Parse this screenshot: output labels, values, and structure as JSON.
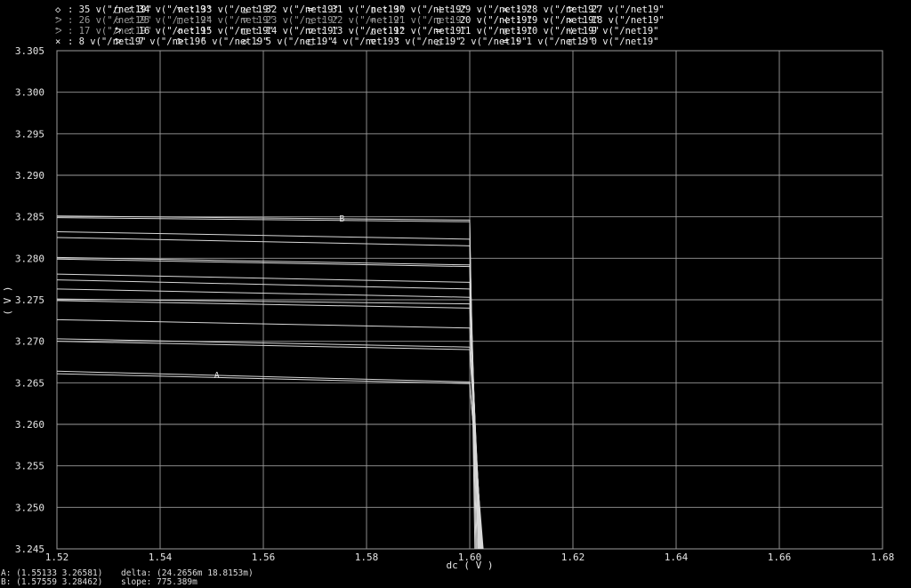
{
  "legend": [
    {
      "sym": "◇",
      "id": "35",
      "label": "v(\"/net19\""
    },
    {
      "sym": "□",
      "id": "34",
      "label": "v(\"/net19\""
    },
    {
      "sym": "▽",
      "id": "33",
      "label": "v(\"/net19\""
    },
    {
      "sym": "△",
      "id": "32",
      "label": "v(\"/net19\""
    },
    {
      "sym": "═",
      "id": "31",
      "label": "v(\"/net19\""
    },
    {
      "sym": "▯",
      "id": "30",
      "label": "v(\"/net19\""
    },
    {
      "sym": "⊹",
      "id": "29",
      "label": "v(\"/net19\""
    },
    {
      "sym": "×",
      "id": "28",
      "label": "v(\"/net19\""
    },
    {
      "sym": "ᕗ",
      "id": "27",
      "label": "v(\"/net19\""
    },
    {
      "sym": "ᕗ",
      "id": "26",
      "label": "v(\"/net19\""
    },
    {
      "sym": "◇",
      "id": "25",
      "label": "v(\"/net19\""
    },
    {
      "sym": "□",
      "id": "24",
      "label": "v(\"/net19\""
    },
    {
      "sym": "▽",
      "id": "23",
      "label": "v(\"/net19\""
    },
    {
      "sym": "△",
      "id": "22",
      "label": "v(\"/net19\""
    },
    {
      "sym": "═",
      "id": "21",
      "label": "v(\"/net19\""
    },
    {
      "sym": "▯",
      "id": "20",
      "label": "v(\"/net19\""
    },
    {
      "sym": "⊹",
      "id": "19",
      "label": "v(\"/net19\""
    },
    {
      "sym": "×",
      "id": "18",
      "label": "v(\"/net19\""
    },
    {
      "sym": "ᕗ",
      "id": "17",
      "label": "v(\"/net19\""
    },
    {
      "sym": "ᕗ",
      "id": "16",
      "label": "v(\"/net19\""
    },
    {
      "sym": "◇",
      "id": "15",
      "label": "v(\"/net19\""
    },
    {
      "sym": "□",
      "id": "14",
      "label": "v(\"/net19\""
    },
    {
      "sym": "▽",
      "id": "13",
      "label": "v(\"/net19\""
    },
    {
      "sym": "△",
      "id": "12",
      "label": "v(\"/net19\""
    },
    {
      "sym": "═",
      "id": "11",
      "label": "v(\"/net19\""
    },
    {
      "sym": "▯",
      "id": "10",
      "label": "v(\"/net19\""
    },
    {
      "sym": "⊹",
      "id": "9",
      "label": "v(\"/net19\""
    },
    {
      "sym": "×",
      "id": "8",
      "label": "v(\"/net19\""
    },
    {
      "sym": "ᕗ",
      "id": "7",
      "label": "v(\"/net19\""
    },
    {
      "sym": "ᕗ",
      "id": "6",
      "label": "v(\"/net19\""
    },
    {
      "sym": "◇",
      "id": "5",
      "label": "v(\"/net19\""
    },
    {
      "sym": "□",
      "id": "4",
      "label": "v(\"/net19\""
    },
    {
      "sym": "▽",
      "id": "3",
      "label": "v(\"/net19\""
    },
    {
      "sym": "△",
      "id": "2",
      "label": "v(\"/net19\""
    },
    {
      "sym": "═",
      "id": "1",
      "label": "v(\"/net19\""
    },
    {
      "sym": "▯",
      "id": "0",
      "label": "v(\"/net19\""
    }
  ],
  "legend_dim_ids": [
    "26",
    "25",
    "24",
    "23",
    "22",
    "21",
    "17"
  ],
  "readout": {
    "a": "A: (1.55133 3.26581)",
    "b": "B: (1.57559 3.28462)",
    "delta": "delta: (24.2656m 18.8153m)",
    "slope": "slope: 775.389m"
  },
  "chart_data": {
    "type": "line",
    "title": "",
    "xlabel": "dc ( V )",
    "ylabel": "( V )",
    "xlim": [
      1.52,
      1.68
    ],
    "ylim": [
      3.245,
      3.305
    ],
    "xticks": [
      "1.52",
      "1.54",
      "1.56",
      "1.58",
      "1.60",
      "1.62",
      "1.64",
      "1.66",
      "1.68"
    ],
    "xtick_values": [
      1.52,
      1.54,
      1.56,
      1.58,
      1.6,
      1.62,
      1.64,
      1.66,
      1.68
    ],
    "yticks": [
      "3.305",
      "3.300",
      "3.295",
      "3.290",
      "3.285",
      "3.280",
      "3.275",
      "3.270",
      "3.265",
      "3.260",
      "3.255",
      "3.250",
      "3.245"
    ],
    "ytick_values": [
      3.305,
      3.3,
      3.295,
      3.29,
      3.285,
      3.28,
      3.275,
      3.27,
      3.265,
      3.26,
      3.255,
      3.25,
      3.245
    ],
    "grid": true,
    "colors": {
      "background": "#000000",
      "grid": "#9b9b9b",
      "trace": "#d8d8d8",
      "text": "#e6e6e6"
    },
    "series": [
      {
        "id": "t0",
        "x": [
          1.52,
          1.6
        ],
        "y": [
          3.2851,
          3.2846
        ],
        "drop_x": 1.601
      },
      {
        "id": "t1",
        "x": [
          1.52,
          1.6
        ],
        "y": [
          3.2849,
          3.2844
        ],
        "drop_x": 1.6012
      },
      {
        "id": "t2",
        "x": [
          1.52,
          1.6
        ],
        "y": [
          3.2832,
          3.2823
        ],
        "drop_x": 1.6014
      },
      {
        "id": "t3",
        "x": [
          1.52,
          1.6
        ],
        "y": [
          3.2825,
          3.2815
        ],
        "drop_x": 1.6016
      },
      {
        "id": "t4",
        "x": [
          1.52,
          1.6
        ],
        "y": [
          3.2801,
          3.2792
        ],
        "drop_x": 1.6017
      },
      {
        "id": "t5",
        "x": [
          1.52,
          1.6
        ],
        "y": [
          3.2799,
          3.279
        ],
        "drop_x": 1.6018
      },
      {
        "id": "t6",
        "x": [
          1.52,
          1.6
        ],
        "y": [
          3.2781,
          3.2771
        ],
        "drop_x": 1.6019
      },
      {
        "id": "t7",
        "x": [
          1.52,
          1.6
        ],
        "y": [
          3.2774,
          3.2763
        ],
        "drop_x": 1.602
      },
      {
        "id": "t8",
        "x": [
          1.52,
          1.6
        ],
        "y": [
          3.2763,
          3.2753
        ],
        "drop_x": 1.6021
      },
      {
        "id": "t9",
        "x": [
          1.52,
          1.6
        ],
        "y": [
          3.2751,
          3.2745
        ],
        "drop_x": 1.6021
      },
      {
        "id": "t10",
        "x": [
          1.52,
          1.6
        ],
        "y": [
          3.2749,
          3.274
        ],
        "drop_x": 1.6022
      },
      {
        "id": "t11",
        "x": [
          1.52,
          1.6
        ],
        "y": [
          3.2726,
          3.2716
        ],
        "drop_x": 1.6023
      },
      {
        "id": "t12",
        "x": [
          1.52,
          1.6
        ],
        "y": [
          3.2703,
          3.2693
        ],
        "drop_x": 1.6024
      },
      {
        "id": "t13",
        "x": [
          1.52,
          1.6
        ],
        "y": [
          3.27,
          3.269
        ],
        "drop_x": 1.6024
      },
      {
        "id": "t14",
        "x": [
          1.52,
          1.6
        ],
        "y": [
          3.2664,
          3.2651
        ],
        "drop_x": 1.6025
      },
      {
        "id": "t15",
        "x": [
          1.52,
          1.6
        ],
        "y": [
          3.2661,
          3.2649
        ],
        "drop_x": 1.6026
      }
    ],
    "markers": [
      {
        "name": "A",
        "x": 1.55133,
        "y": 3.26581
      },
      {
        "name": "B",
        "x": 1.57559,
        "y": 3.28462
      }
    ]
  }
}
